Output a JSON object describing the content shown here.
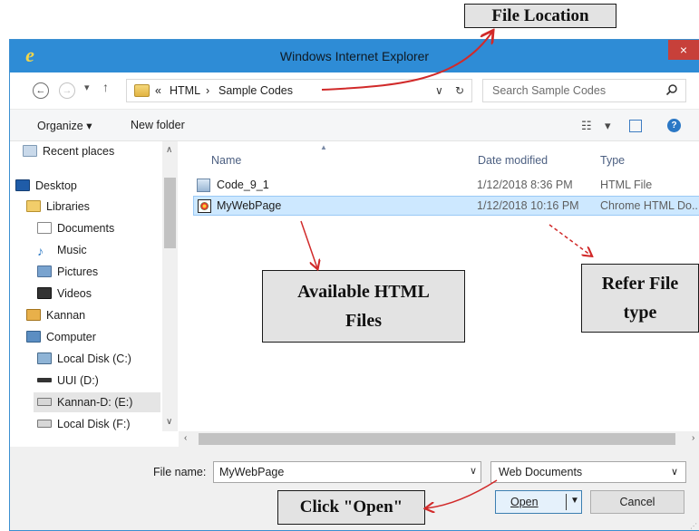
{
  "window": {
    "title": "Windows Internet Explorer",
    "close_glyph": "×"
  },
  "address_bar": {
    "overflow": "«",
    "breadcrumbs": [
      "HTML",
      "Sample Codes"
    ],
    "separator": "›",
    "dropdown_glyph": "∨",
    "refresh_glyph": "↻",
    "search_placeholder": "Search Sample Codes"
  },
  "toolbar": {
    "organize_label": "Organize ▾",
    "new_folder_label": "New folder",
    "view_dropdown": "▾",
    "help_glyph": "?"
  },
  "nav_pane": {
    "items": [
      {
        "label": "Recent places",
        "icon": "recent-places-icon"
      },
      {
        "label": "Desktop",
        "icon": "desktop-icon"
      },
      {
        "label": "Libraries",
        "icon": "libraries-icon"
      },
      {
        "label": "Documents",
        "icon": "documents-icon"
      },
      {
        "label": "Music",
        "icon": "music-icon"
      },
      {
        "label": "Pictures",
        "icon": "pictures-icon"
      },
      {
        "label": "Videos",
        "icon": "videos-icon"
      },
      {
        "label": "Kannan",
        "icon": "user-icon"
      },
      {
        "label": "Computer",
        "icon": "computer-icon"
      },
      {
        "label": "Local Disk (C:)",
        "icon": "local-disk-icon"
      },
      {
        "label": "UUI (D:)",
        "icon": "drive-icon"
      },
      {
        "label": "Kannan-D: (E:)",
        "icon": "drive-icon",
        "selected": true
      },
      {
        "label": "Local Disk (F:)",
        "icon": "drive-icon"
      }
    ]
  },
  "file_list": {
    "columns": [
      "Name",
      "Date modified",
      "Type"
    ],
    "rows": [
      {
        "name": "Code_9_1",
        "date": "1/12/2018 8:36 PM",
        "type": "HTML File",
        "icon": "html-file-icon",
        "selected": false
      },
      {
        "name": "MyWebPage",
        "date": "1/12/2018 10:16 PM",
        "type": "Chrome HTML Do...",
        "icon": "chrome-html-icon",
        "selected": true
      }
    ]
  },
  "footer": {
    "file_name_label": "File name:",
    "file_name_value": "MyWebPage",
    "file_type_value": "Web Documents",
    "open_label": "Open",
    "cancel_label": "Cancel"
  },
  "annotations": {
    "file_location": "File Location",
    "available_html": "Available HTML\nFiles",
    "refer_file_type": "Refer File\ntype",
    "click_open": "Click \"Open\""
  },
  "colors": {
    "titlebar": "#2e8cd6",
    "close_button": "#c7403a",
    "selection": "#cde8ff",
    "arrow": "#d12a2a",
    "callout_bg": "#e3e3e3"
  }
}
